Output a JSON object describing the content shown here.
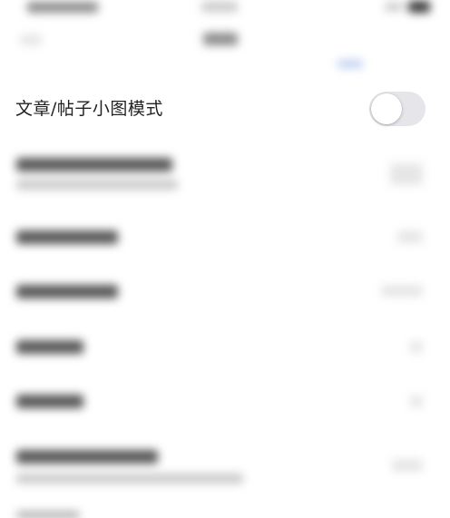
{
  "settings": {
    "small_image_mode": {
      "label": "文章/帖子小图模式",
      "enabled": false
    }
  },
  "colors": {
    "toggle_off": "#e5e5ea",
    "toggle_on": "#34c759",
    "label_text": "#222222",
    "accent_blur": "#4a7bd6"
  }
}
